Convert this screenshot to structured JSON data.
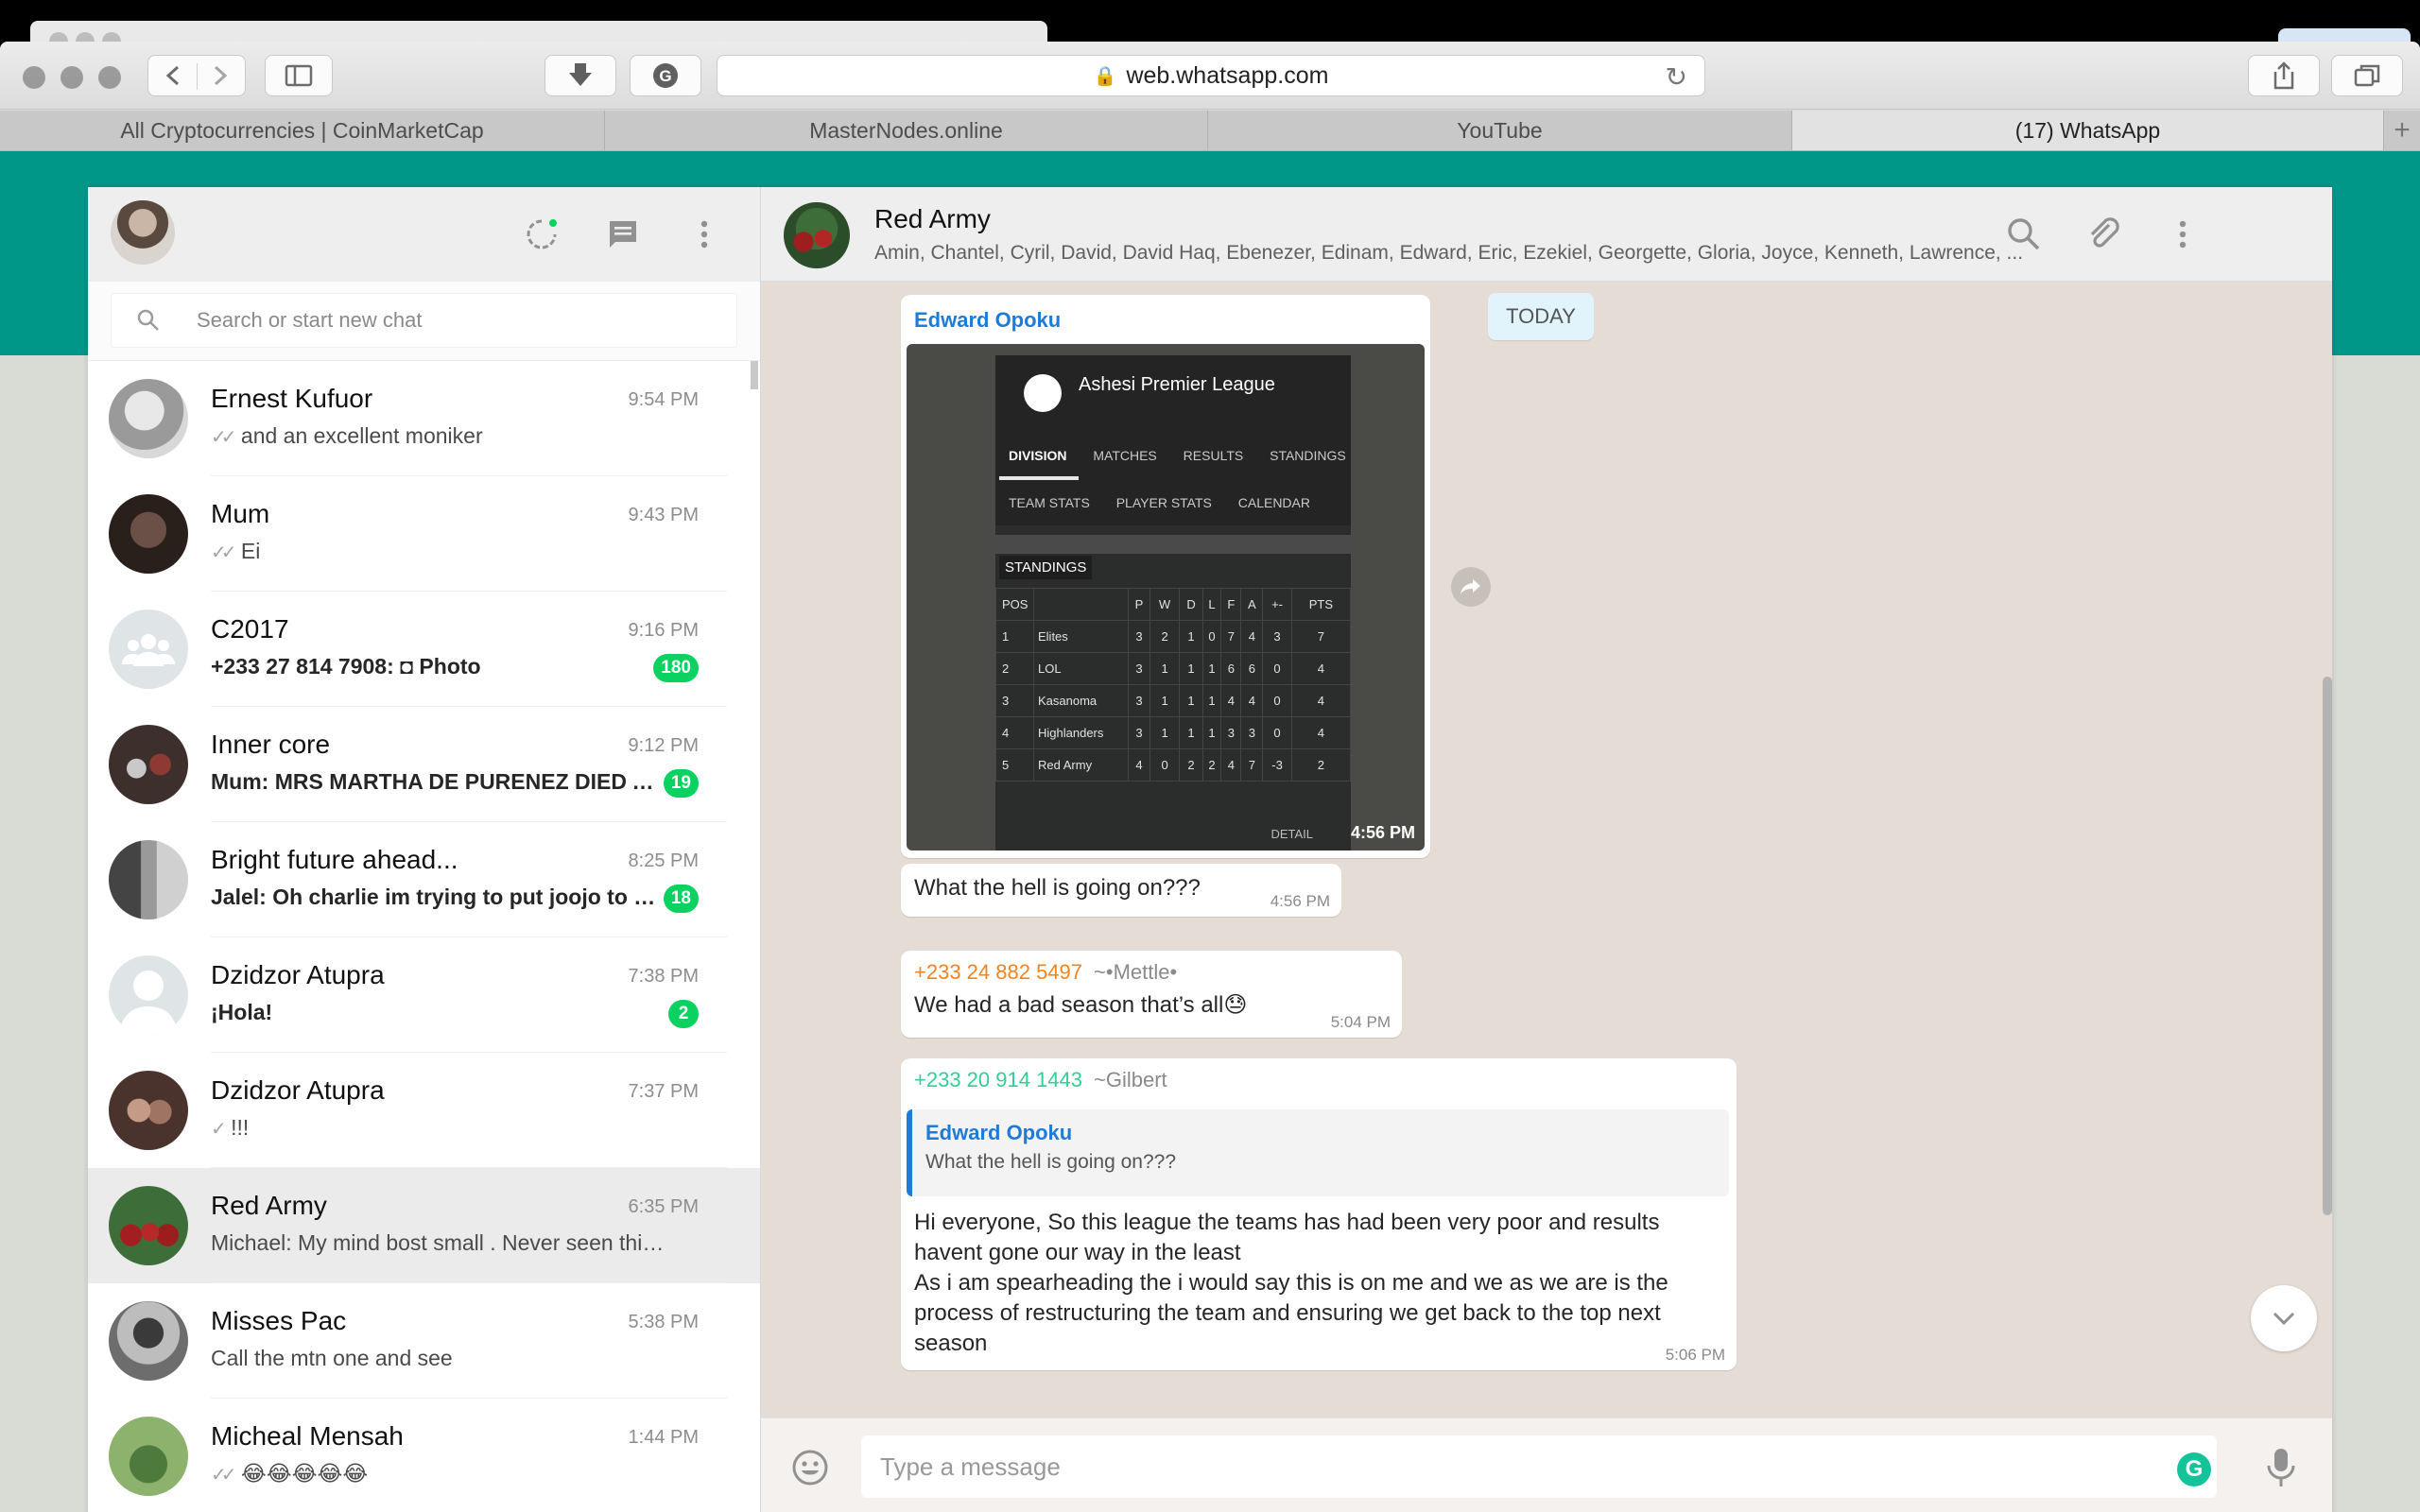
{
  "browser": {
    "url": "web.whatsapp.com",
    "tabs": [
      {
        "label": "All Cryptocurrencies | CoinMarketCap",
        "active": false
      },
      {
        "label": "MasterNodes.online",
        "active": false
      },
      {
        "label": "YouTube",
        "active": false
      },
      {
        "label": "(17) WhatsApp",
        "active": true
      }
    ],
    "new_tab_label": "+"
  },
  "sidebar": {
    "search_placeholder": "Search or start new chat",
    "chats": [
      {
        "name": "Ernest Kufuor",
        "time": "9:54 PM",
        "preview": "and an excellent moniker",
        "ticks": "✓✓",
        "unread": "",
        "avatar": "#b8b8b8"
      },
      {
        "name": "Mum",
        "time": "9:43 PM",
        "preview": "Ei",
        "ticks": "✓✓",
        "unread": "",
        "avatar": "#3a2c25"
      },
      {
        "name": "C2017",
        "time": "9:16 PM",
        "preview": "+233 27 814 7908: ◘ Photo",
        "ticks": "",
        "unread": "180",
        "avatar": "#dfe5e7"
      },
      {
        "name": "Inner core",
        "time": "9:12 PM",
        "preview": "Mum: MRS MARTHA DE PURENEZ DIED AT ...",
        "ticks": "",
        "unread": "19",
        "avatar": "#4a3a36"
      },
      {
        "name": "Bright future ahead...",
        "time": "8:25 PM",
        "preview": "Jalel: Oh charlie im trying to put joojo to sle...",
        "ticks": "",
        "unread": "18",
        "avatar": "#6a6a6a"
      },
      {
        "name": "Dzidzor Atupra",
        "time": "7:38 PM",
        "preview": "¡Hola!",
        "ticks": "",
        "unread": "2",
        "avatar": "#dfe5e7"
      },
      {
        "name": "Dzidzor Atupra",
        "time": "7:37 PM",
        "preview": "!!!",
        "ticks": "✓",
        "unread": "",
        "avatar": "#7a5b52"
      },
      {
        "name": "Red Army",
        "time": "6:35 PM",
        "preview": "Michael: My mind bost small . Never seen this b...",
        "ticks": "",
        "unread": "",
        "avatar": "#3d6e3a"
      },
      {
        "name": "Misses Pac",
        "time": "5:38 PM",
        "preview": "Call the mtn one and see",
        "ticks": "",
        "unread": "",
        "avatar": "#8b8b8b"
      },
      {
        "name": "Micheal Mensah",
        "time": "1:44 PM",
        "preview": "😂😂😂😂😂",
        "ticks": "✓✓",
        "unread": "",
        "avatar": "#6f8a5c"
      }
    ]
  },
  "conversation": {
    "name": "Red Army",
    "members": "Amin, Chantel, Cyril, David, David Haq, Ebenezer, Edinam, Edward, Eric, Ezekiel, Georgette, Gloria, Joyce, Kenneth, Lawrence, ...",
    "date_label": "TODAY",
    "photo_message": {
      "sender": "Edward Opoku",
      "time": "4:56 PM",
      "screenshot": {
        "title": "Ashesi Premier League",
        "nav1": [
          "DIVISION",
          "MATCHES",
          "RESULTS",
          "STANDINGS"
        ],
        "nav2": [
          "TEAM STATS",
          "PLAYER STATS",
          "CALENDAR"
        ],
        "section": "STANDINGS",
        "columns": [
          "POS",
          "",
          "P",
          "W",
          "D",
          "L",
          "F",
          "A",
          "+-",
          "PTS"
        ],
        "rows": [
          [
            "1",
            "Elites",
            "3",
            "2",
            "1",
            "0",
            "7",
            "4",
            "3",
            "7"
          ],
          [
            "2",
            "LOL",
            "3",
            "1",
            "1",
            "1",
            "6",
            "6",
            "0",
            "4"
          ],
          [
            "3",
            "Kasanoma",
            "3",
            "1",
            "1",
            "1",
            "4",
            "4",
            "0",
            "4"
          ],
          [
            "4",
            "Highlanders",
            "3",
            "1",
            "1",
            "1",
            "3",
            "3",
            "0",
            "4"
          ],
          [
            "5",
            "Red Army",
            "4",
            "0",
            "2",
            "2",
            "4",
            "7",
            "-3",
            "2"
          ]
        ],
        "detail": "DETAIL"
      }
    },
    "msg2": {
      "text": "What the hell is going on???",
      "time": "4:56 PM"
    },
    "msg3": {
      "sender": "+233 24 882 5497",
      "alias": "~•Mettle•",
      "text": "We had a bad season that’s all😓",
      "time": "5:04 PM"
    },
    "msg4": {
      "sender": "+233 20 914 1443",
      "alias": "~Gilbert",
      "quote_name": "Edward Opoku",
      "quote_text": "What the hell is going on???",
      "text1": "Hi everyone, So this league the teams has had been very poor and results havent gone our way in the least",
      "text2": "As i am spearheading the i would say this is on me and we as we are is the process of restructuring the team and ensuring we get back to the top next season",
      "time": "5:06 PM"
    },
    "composer_placeholder": "Type a message"
  },
  "colors": {
    "teal": "#009688",
    "unread_badge": "#09d261",
    "sender_blue": "#1f7bd8",
    "sender_orange": "#f5831f",
    "sender_teal": "#35cd96"
  }
}
